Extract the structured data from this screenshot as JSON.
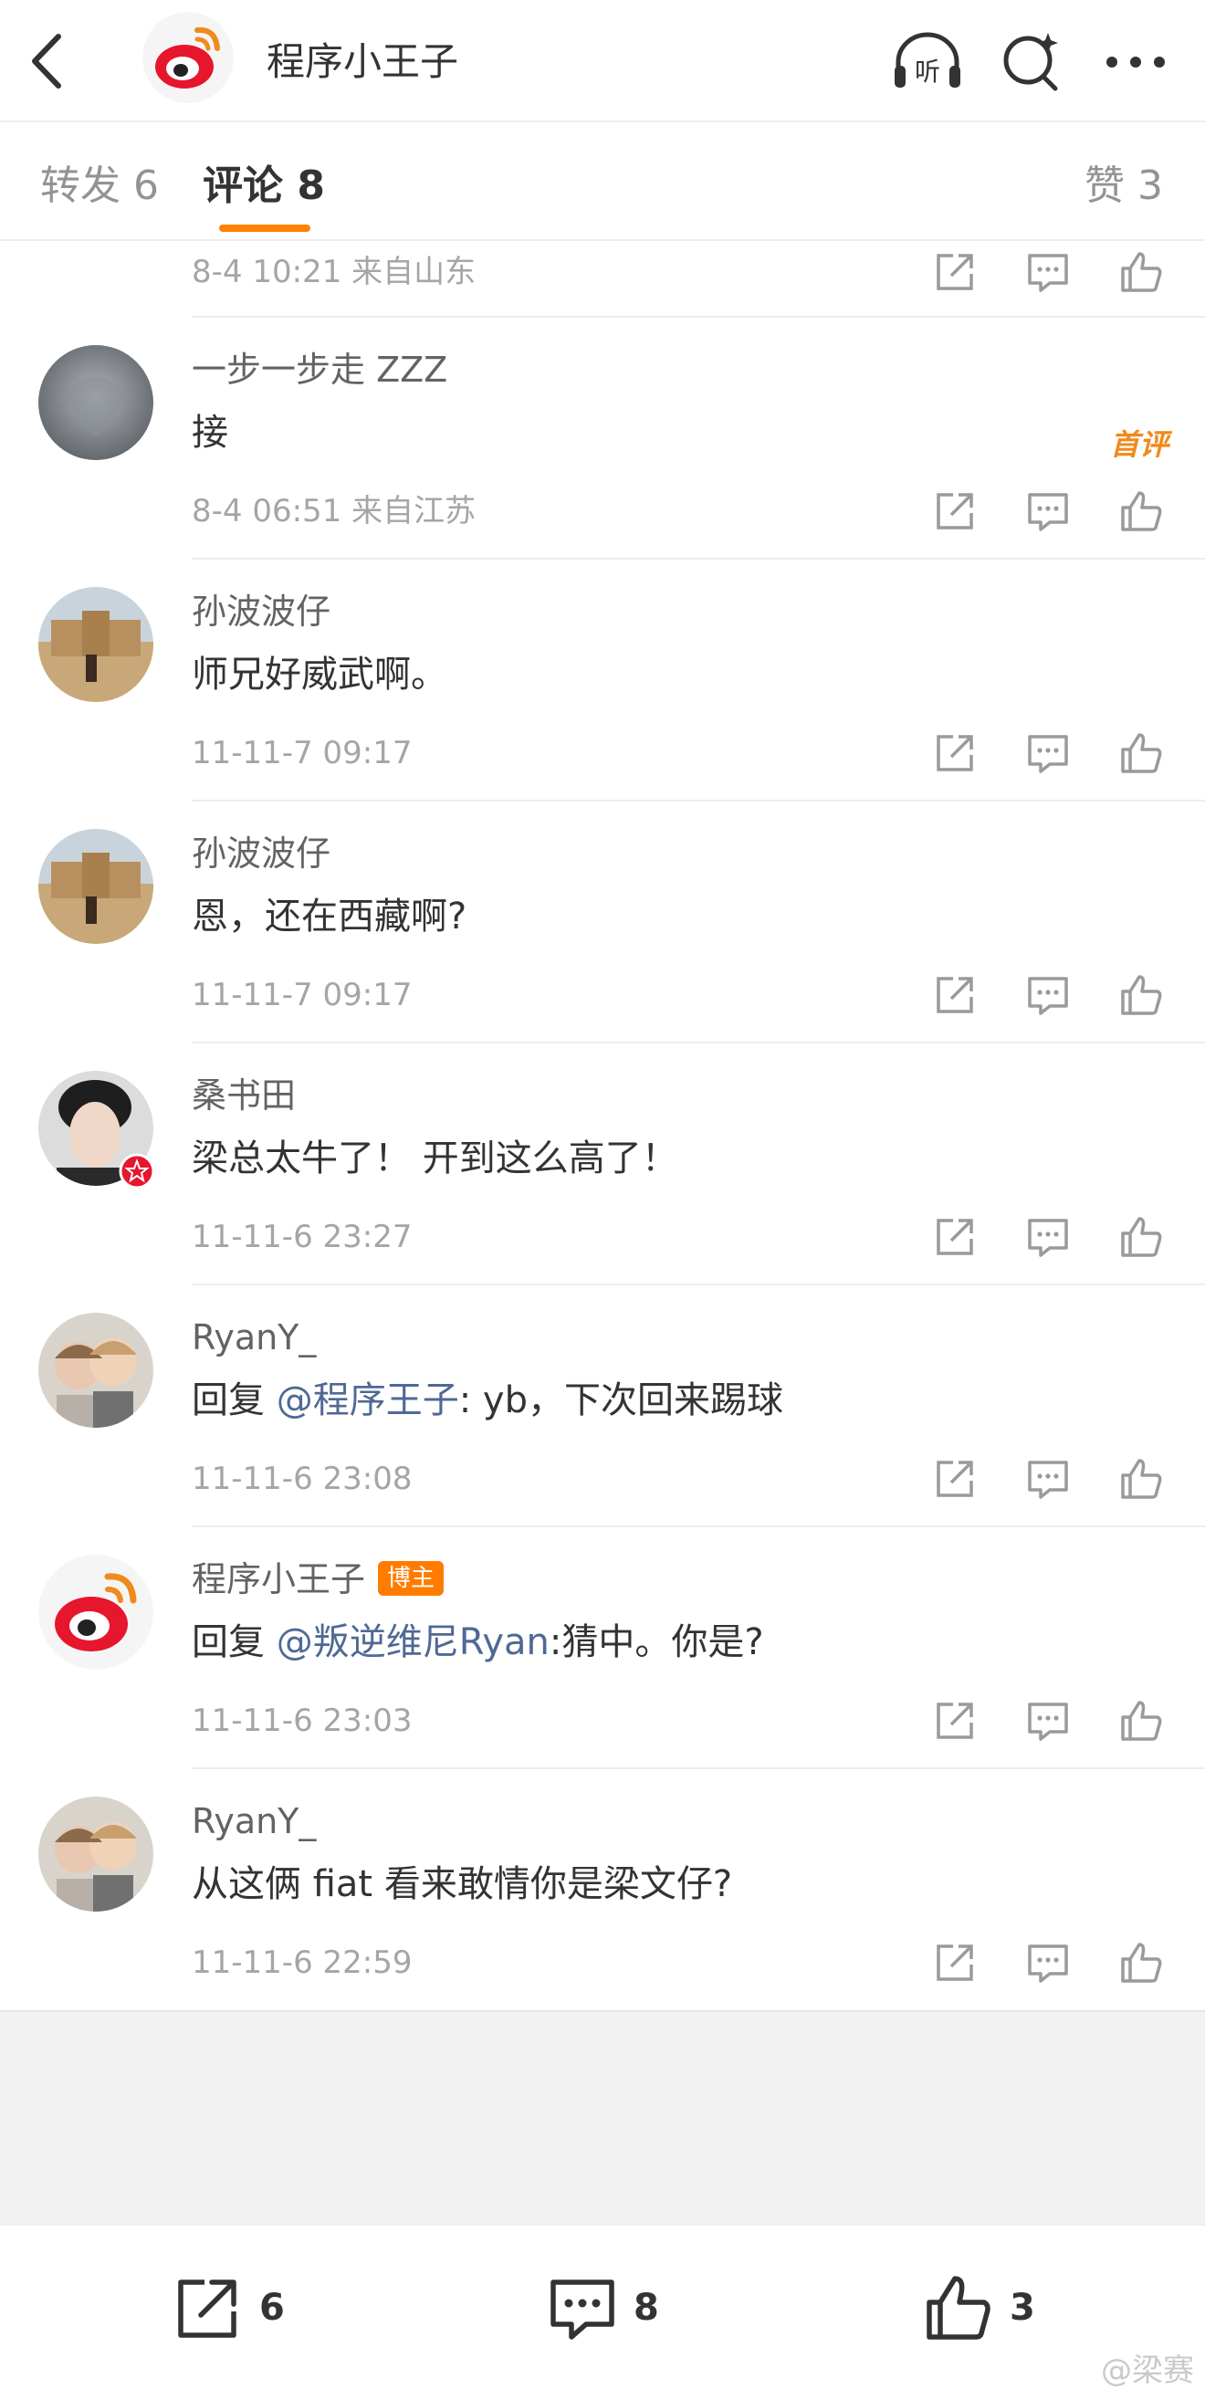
{
  "header": {
    "title": "程序小王子",
    "back_icon": "chevron-left-icon",
    "listen_label": "听",
    "brand_color": "#e6162d"
  },
  "tabs": {
    "repost": "转发 6",
    "comments": "评论 8",
    "likes": "赞 3",
    "accent_color": "#ff8200"
  },
  "comments": [
    {
      "meta": "8-4 10:21 来自山东"
    },
    {
      "username": "一步一步走 ZZZ",
      "text": "接",
      "meta": "8-4 06:51 来自江苏",
      "badge": "首评"
    },
    {
      "username": "孙波波仔",
      "text": "师兄好威武啊。",
      "meta": "11-11-7 09:17"
    },
    {
      "username": "孙波波仔",
      "text": "恩，还在西藏啊?",
      "meta": "11-11-7 09:17"
    },
    {
      "username": "桑书田",
      "text": "梁总太牛了！ 开到这么高了！",
      "meta": "11-11-6 23:27"
    },
    {
      "username": "RyanY_",
      "text_prefix": "回复 ",
      "mention": "@程序王子",
      "text_suffix": ": yb，下次回来踢球",
      "meta": "11-11-6 23:08"
    },
    {
      "username": "程序小王子",
      "badge": "博主",
      "text_prefix": "回复 ",
      "mention": "@叛逆维尼Ryan",
      "text_suffix": ":猜中。你是?",
      "meta": "11-11-6 23:03"
    },
    {
      "username": "RyanY_",
      "text": "从这俩 fiat 看来敢情你是梁文仔?",
      "meta": "11-11-6 22:59"
    }
  ],
  "bottom_bar": {
    "share_count": "6",
    "comment_count": "8",
    "like_count": "3"
  },
  "watermark": "@梁赛"
}
